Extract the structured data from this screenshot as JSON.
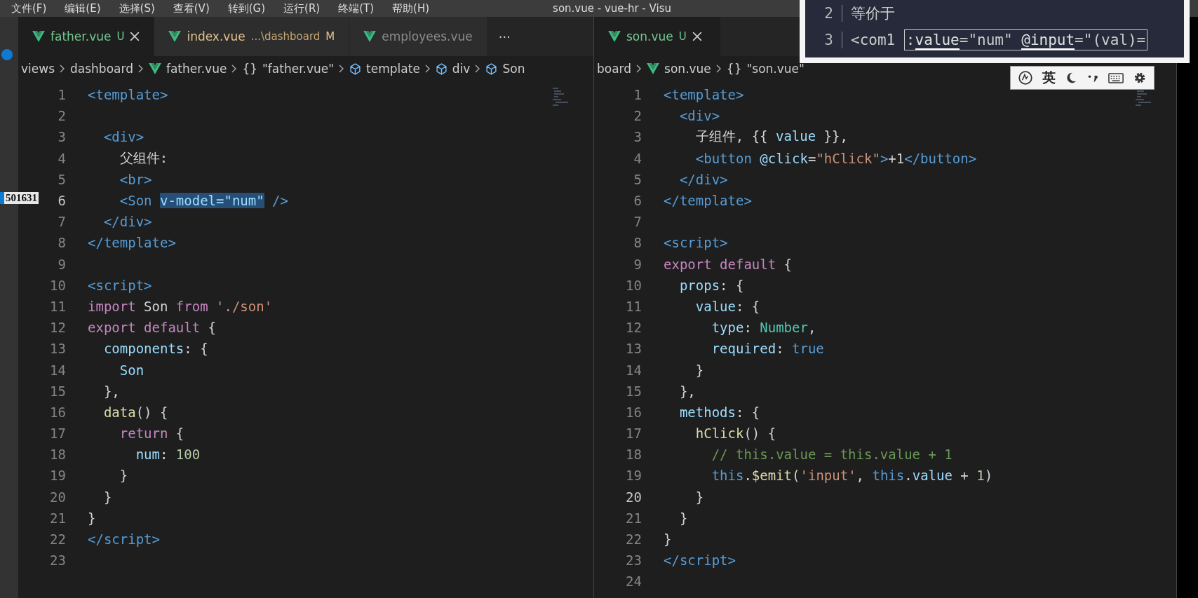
{
  "menu_bar": {
    "items": [
      "文件(F)",
      "编辑(E)",
      "选择(S)",
      "查看(V)",
      "转到(G)",
      "运行(R)",
      "终端(T)",
      "帮助(H)"
    ],
    "title": "son.vue - vue-hr - Visu"
  },
  "activity_bar": {
    "badge": "501631"
  },
  "panes": [
    {
      "tabs": [
        {
          "label": "father.vue",
          "badge": "U",
          "kind": "untracked",
          "selected": true
        },
        {
          "label": "index.vue",
          "detail": "...\\dashboard",
          "badge": "M",
          "kind": "modified",
          "selected": false
        },
        {
          "label": "employees.vue",
          "kind": "clean",
          "selected": false
        }
      ],
      "more": "···",
      "breadcrumb": [
        {
          "kind": "folder",
          "text": "views"
        },
        {
          "kind": "folder",
          "text": "dashboard"
        },
        {
          "kind": "file",
          "text": "father.vue"
        },
        {
          "kind": "module",
          "glyph": "{}",
          "text": "\"father.vue\""
        },
        {
          "kind": "element",
          "text": "template"
        },
        {
          "kind": "element",
          "text": "div"
        },
        {
          "kind": "element",
          "text": "Son"
        }
      ],
      "lines": [
        {
          "n": "1",
          "current": false,
          "t": [
            {
              "kind": "tag",
              "text": "<template>"
            }
          ]
        },
        {
          "n": "2",
          "current": false
        },
        {
          "n": "3",
          "current": false,
          "t": [
            {
              "kind": "tag",
              "text": "  <div>"
            }
          ]
        },
        {
          "n": "4",
          "current": false,
          "t": [
            {
              "kind": "plain",
              "text": "    父组件:"
            }
          ]
        },
        {
          "n": "5",
          "current": false,
          "t": [
            {
              "kind": "tag",
              "text": "    <br>"
            }
          ]
        },
        {
          "n": "6",
          "current": true,
          "t": [
            {
              "kind": "tag",
              "text": "    <Son "
            },
            {
              "kind": "highlight",
              "text": "v-model=\"num\""
            },
            {
              "kind": "tag",
              "text": " />"
            }
          ]
        },
        {
          "n": "7",
          "current": false,
          "t": [
            {
              "kind": "tag",
              "text": "  </div>"
            }
          ]
        },
        {
          "n": "8",
          "current": false,
          "t": [
            {
              "kind": "tag",
              "text": "</template>"
            }
          ]
        },
        {
          "n": "9",
          "current": false
        },
        {
          "n": "10",
          "current": false,
          "t": [
            {
              "kind": "tag",
              "text": "<script>"
            }
          ]
        },
        {
          "n": "11",
          "current": false,
          "t": [
            {
              "kind": "keyword",
              "text": "import "
            },
            {
              "kind": "plain",
              "text": "Son "
            },
            {
              "kind": "keyword",
              "text": "from "
            },
            {
              "kind": "string",
              "text": "'./son'"
            }
          ]
        },
        {
          "n": "12",
          "current": false,
          "t": [
            {
              "kind": "keyword",
              "text": "export default "
            },
            {
              "kind": "plain",
              "text": "{"
            }
          ]
        },
        {
          "n": "13",
          "current": false,
          "t": [
            {
              "kind": "property",
              "text": "  components"
            },
            {
              "kind": "plain",
              "text": ": {"
            }
          ]
        },
        {
          "n": "14",
          "current": false,
          "t": [
            {
              "kind": "property",
              "text": "    Son"
            }
          ]
        },
        {
          "n": "15",
          "current": false,
          "t": [
            {
              "kind": "plain",
              "text": "  },"
            }
          ]
        },
        {
          "n": "16",
          "current": false,
          "t": [
            {
              "kind": "function",
              "text": "  data"
            },
            {
              "kind": "plain",
              "text": "() {"
            }
          ]
        },
        {
          "n": "17",
          "current": false,
          "t": [
            {
              "kind": "keyword",
              "text": "    return "
            },
            {
              "kind": "plain",
              "text": "{"
            }
          ]
        },
        {
          "n": "18",
          "current": false,
          "t": [
            {
              "kind": "property",
              "text": "      num"
            },
            {
              "kind": "plain",
              "text": ": "
            },
            {
              "kind": "number",
              "text": "100"
            }
          ]
        },
        {
          "n": "19",
          "current": false,
          "t": [
            {
              "kind": "plain",
              "text": "    }"
            }
          ]
        },
        {
          "n": "20",
          "current": false,
          "t": [
            {
              "kind": "plain",
              "text": "  }"
            }
          ]
        },
        {
          "n": "21",
          "current": false,
          "t": [
            {
              "kind": "plain",
              "text": "}"
            }
          ]
        },
        {
          "n": "22",
          "current": false,
          "t": [
            {
              "kind": "tag",
              "text": "</script>"
            }
          ]
        },
        {
          "n": "23",
          "current": false
        }
      ]
    },
    {
      "tabs": [
        {
          "label": "son.vue",
          "badge": "U",
          "kind": "untracked",
          "selected": true
        }
      ],
      "breadcrumb": [
        {
          "kind": "folder",
          "text": "board"
        },
        {
          "kind": "file",
          "text": "son.vue"
        },
        {
          "kind": "module",
          "glyph": "{}",
          "text": "\"son.vue\""
        }
      ],
      "lines": [
        {
          "n": "1",
          "current": false,
          "t": [
            {
              "kind": "tag",
              "text": "<template>"
            }
          ]
        },
        {
          "n": "2",
          "current": false,
          "t": [
            {
              "kind": "tag",
              "text": "  <div>"
            }
          ]
        },
        {
          "n": "3",
          "current": false,
          "t": [
            {
              "kind": "plain",
              "text": "    子组件, {{ "
            },
            {
              "kind": "property",
              "text": "value"
            },
            {
              "kind": "plain",
              "text": " }},"
            }
          ]
        },
        {
          "n": "4",
          "current": false,
          "t": [
            {
              "kind": "tag",
              "text": "    <button "
            },
            {
              "kind": "attribute",
              "text": "@click"
            },
            {
              "kind": "plain",
              "text": "="
            },
            {
              "kind": "string",
              "text": "\"hClick\""
            },
            {
              "kind": "tag",
              "text": ">"
            },
            {
              "kind": "plain",
              "text": "+1"
            },
            {
              "kind": "tag",
              "text": "</button>"
            }
          ]
        },
        {
          "n": "5",
          "current": false,
          "t": [
            {
              "kind": "tag",
              "text": "  </div>"
            }
          ]
        },
        {
          "n": "6",
          "current": false,
          "t": [
            {
              "kind": "tag",
              "text": "</template>"
            }
          ]
        },
        {
          "n": "7",
          "current": false
        },
        {
          "n": "8",
          "current": false,
          "t": [
            {
              "kind": "tag",
              "text": "<script>"
            }
          ]
        },
        {
          "n": "9",
          "current": false,
          "t": [
            {
              "kind": "keyword",
              "text": "export default "
            },
            {
              "kind": "plain",
              "text": "{"
            }
          ]
        },
        {
          "n": "10",
          "current": false,
          "t": [
            {
              "kind": "property",
              "text": "  props"
            },
            {
              "kind": "plain",
              "text": ": {"
            }
          ]
        },
        {
          "n": "11",
          "current": false,
          "t": [
            {
              "kind": "property",
              "text": "    value"
            },
            {
              "kind": "plain",
              "text": ": {"
            }
          ]
        },
        {
          "n": "12",
          "current": false,
          "t": [
            {
              "kind": "property",
              "text": "      type"
            },
            {
              "kind": "plain",
              "text": ": "
            },
            {
              "kind": "type",
              "text": "Number"
            },
            {
              "kind": "plain",
              "text": ","
            }
          ]
        },
        {
          "n": "13",
          "current": false,
          "t": [
            {
              "kind": "property",
              "text": "      required"
            },
            {
              "kind": "plain",
              "text": ": "
            },
            {
              "kind": "constant",
              "text": "true"
            }
          ]
        },
        {
          "n": "14",
          "current": false,
          "t": [
            {
              "kind": "plain",
              "text": "    }"
            }
          ]
        },
        {
          "n": "15",
          "current": false,
          "t": [
            {
              "kind": "plain",
              "text": "  },"
            }
          ]
        },
        {
          "n": "16",
          "current": false,
          "t": [
            {
              "kind": "property",
              "text": "  methods"
            },
            {
              "kind": "plain",
              "text": ": {"
            }
          ]
        },
        {
          "n": "17",
          "current": false,
          "t": [
            {
              "kind": "function",
              "text": "    hClick"
            },
            {
              "kind": "plain",
              "text": "() {"
            }
          ]
        },
        {
          "n": "18",
          "current": false,
          "t": [
            {
              "kind": "comment",
              "text": "      // this.value = this.value + 1"
            }
          ]
        },
        {
          "n": "19",
          "current": false,
          "t": [
            {
              "kind": "constant",
              "text": "      this"
            },
            {
              "kind": "plain",
              "text": "."
            },
            {
              "kind": "function",
              "text": "$emit"
            },
            {
              "kind": "plain",
              "text": "("
            },
            {
              "kind": "string",
              "text": "'input'"
            },
            {
              "kind": "plain",
              "text": ", "
            },
            {
              "kind": "constant",
              "text": "this"
            },
            {
              "kind": "plain",
              "text": "."
            },
            {
              "kind": "property",
              "text": "value"
            },
            {
              "kind": "plain",
              "text": " + "
            },
            {
              "kind": "number",
              "text": "1"
            },
            {
              "kind": "plain",
              "text": ")"
            }
          ]
        },
        {
          "n": "20",
          "current": true,
          "t": [
            {
              "kind": "plain",
              "text": "    }"
            }
          ]
        },
        {
          "n": "21",
          "current": false,
          "t": [
            {
              "kind": "plain",
              "text": "  }"
            }
          ]
        },
        {
          "n": "22",
          "current": false,
          "t": [
            {
              "kind": "plain",
              "text": "}"
            }
          ]
        },
        {
          "n": "23",
          "current": false,
          "t": [
            {
              "kind": "tag",
              "text": "</script>"
            }
          ]
        },
        {
          "n": "24",
          "current": false
        }
      ]
    }
  ],
  "snippet": {
    "lines": [
      {
        "n": "2",
        "text": "等价于"
      },
      {
        "n": "3",
        "text": "<com1 ",
        "boxed": [
          {
            "kind": "plain",
            "text": ":"
          },
          {
            "kind": "underlined",
            "text": "value"
          },
          {
            "kind": "plain",
            "text": "=\"num\" "
          },
          {
            "kind": "underlined",
            "text": "@input"
          },
          {
            "kind": "plain",
            "text": "=\"(val)="
          }
        ]
      }
    ]
  },
  "ime_toolbar": {
    "label": "英"
  }
}
